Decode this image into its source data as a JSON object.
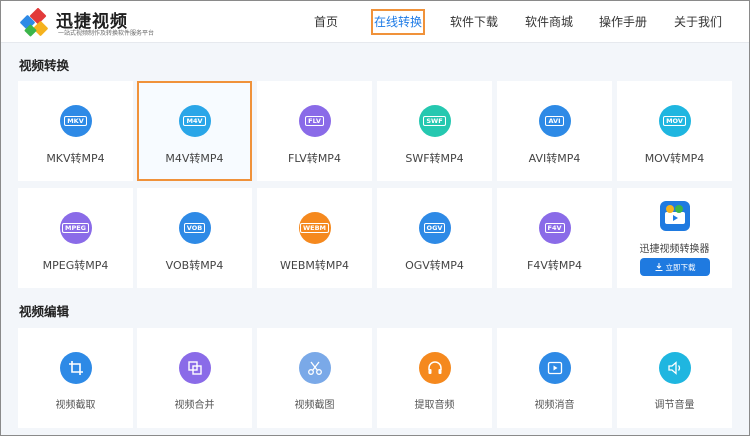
{
  "header": {
    "logo_title": "迅捷视频",
    "logo_slogan": "一站式视频制作及转换软件服务平台",
    "nav": [
      {
        "label": "首页"
      },
      {
        "label": "在线转换"
      },
      {
        "label": "软件下载"
      },
      {
        "label": "软件商城"
      },
      {
        "label": "操作手册"
      },
      {
        "label": "关于我们"
      }
    ],
    "active_nav": "在线转换"
  },
  "convert": {
    "title": "视频转换",
    "items": [
      {
        "badge": "MKV",
        "label": "MKV转MP4",
        "color": "#2e8ae6",
        "selected": false
      },
      {
        "badge": "M4V",
        "label": "M4V转MP4",
        "color": "#2aa6e8",
        "selected": true
      },
      {
        "badge": "FLV",
        "label": "FLV转MP4",
        "color": "#8a6be8",
        "selected": false
      },
      {
        "badge": "SWF",
        "label": "SWF转MP4",
        "color": "#25c8b0",
        "selected": false
      },
      {
        "badge": "AVI",
        "label": "AVI转MP4",
        "color": "#2e8ae6",
        "selected": false
      },
      {
        "badge": "MOV",
        "label": "MOV转MP4",
        "color": "#1fb6e0",
        "selected": false
      },
      {
        "badge": "MPEG",
        "label": "MPEG转MP4",
        "color": "#8a6be8",
        "selected": false
      },
      {
        "badge": "VOB",
        "label": "VOB转MP4",
        "color": "#2e8ae6",
        "selected": false
      },
      {
        "badge": "WEBM",
        "label": "WEBM转MP4",
        "color": "#f5891e",
        "selected": false
      },
      {
        "badge": "OGV",
        "label": "OGV转MP4",
        "color": "#2e8ae6",
        "selected": false
      },
      {
        "badge": "F4V",
        "label": "F4V转MP4",
        "color": "#8a6be8",
        "selected": false
      }
    ],
    "promo": {
      "label": "迅捷视频转换器",
      "button_label": "立即下载"
    }
  },
  "edit": {
    "title": "视频编辑",
    "items": [
      {
        "icon": "crop-icon",
        "label": "视频截取",
        "color": "#2e8ae6"
      },
      {
        "icon": "merge-icon",
        "label": "视频合并",
        "color": "#8a6be8"
      },
      {
        "icon": "scissors-icon",
        "label": "视频截图",
        "color": "#7aa9e8"
      },
      {
        "icon": "headphones-icon",
        "label": "提取音频",
        "color": "#f5891e"
      },
      {
        "icon": "play-icon",
        "label": "视频消音",
        "color": "#2e8ae6"
      },
      {
        "icon": "volume-icon",
        "label": "调节音量",
        "color": "#1fb6e0"
      }
    ]
  }
}
